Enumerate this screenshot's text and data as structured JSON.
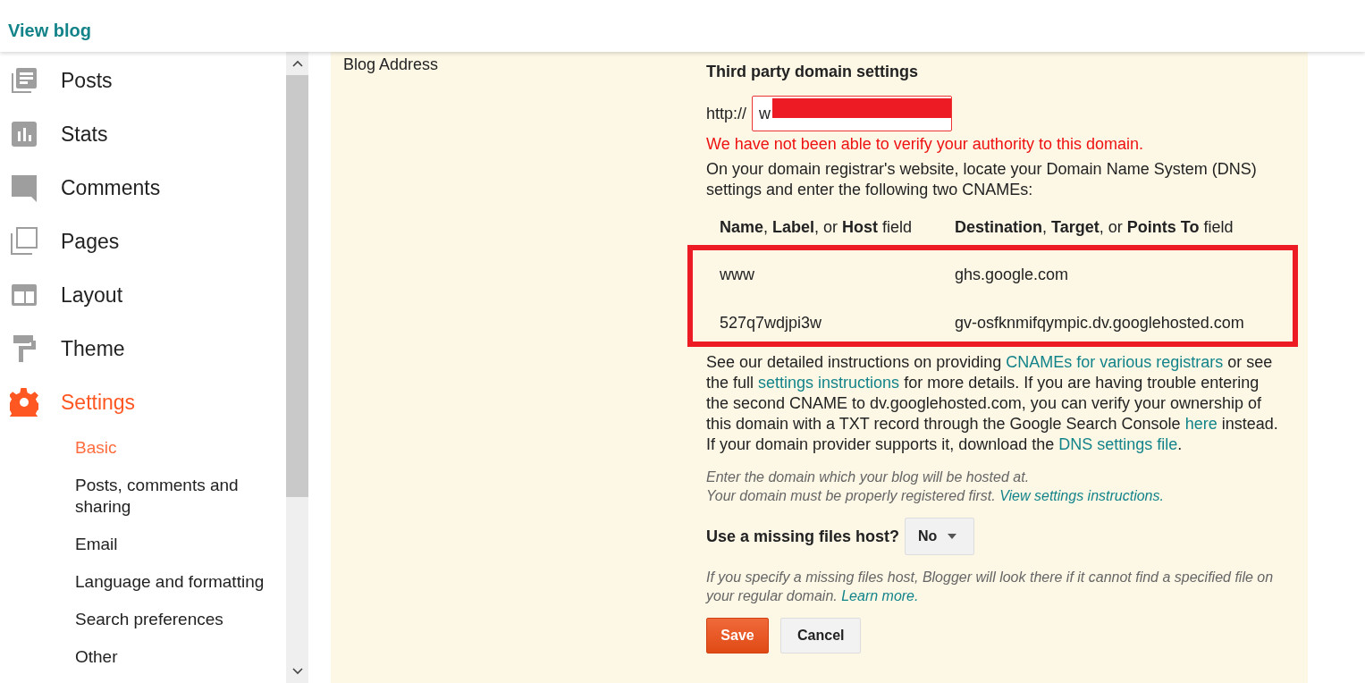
{
  "header": {
    "link": "View blog"
  },
  "sidebar": {
    "items": [
      {
        "label": "Posts",
        "kind": "posts",
        "selected": false
      },
      {
        "label": "Stats",
        "kind": "stats",
        "selected": false
      },
      {
        "label": "Comments",
        "kind": "comments",
        "selected": false
      },
      {
        "label": "Pages",
        "kind": "pages",
        "selected": false
      },
      {
        "label": "Layout",
        "kind": "layout",
        "selected": false
      },
      {
        "label": "Theme",
        "kind": "theme",
        "selected": false
      },
      {
        "label": "Settings",
        "kind": "settings",
        "selected": true
      }
    ],
    "subitems": [
      {
        "label": "Basic",
        "selected": true
      },
      {
        "label": "Posts, comments and sharing",
        "selected": false
      },
      {
        "label": "Email",
        "selected": false
      },
      {
        "label": "Language and formatting",
        "selected": false
      },
      {
        "label": "Search preferences",
        "selected": false
      },
      {
        "label": "Other",
        "selected": false
      }
    ]
  },
  "section": {
    "label": "Blog Address",
    "heading": "Third party domain settings",
    "prefix": "http://",
    "domain_value": "w",
    "domain_redacted": true,
    "error": "We have not been able to verify your authority to this domain.",
    "intro": "On your domain registrar's website, locate your Domain Name System (DNS) settings and enter the following two CNAMEs:",
    "table": {
      "columns": [
        "**Name**, **Label**, or **Host** field",
        "**Destination**, **Target**, or **Points To** field"
      ],
      "highlighted": true,
      "rows": [
        [
          "www",
          "ghs.google.com"
        ],
        [
          "527q7wdjpi3w",
          "gv-osfknmifqympic.dv.googlehosted.com"
        ]
      ]
    },
    "instructions": [
      {
        "kind": "text",
        "text": "See our detailed instructions on providing "
      },
      {
        "kind": "link",
        "text": "CNAMEs for various registrars"
      },
      {
        "kind": "text",
        "text": " or see the full "
      },
      {
        "kind": "link",
        "text": "settings instructions"
      },
      {
        "kind": "text",
        "text": " for more details. If you are having trouble entering the second CNAME to dv.googlehosted.com, you can verify your ownership of this domain with a TXT record through the Google Search Console "
      },
      {
        "kind": "link",
        "text": "here"
      },
      {
        "kind": "text",
        "text": " instead."
      },
      {
        "kind": "break"
      },
      {
        "kind": "text",
        "text": "If your domain provider supports it, download the "
      },
      {
        "kind": "link",
        "text": "DNS settings file"
      },
      {
        "kind": "text",
        "text": "."
      }
    ],
    "hint": [
      {
        "kind": "text",
        "text": "Enter the domain which your blog will be hosted at."
      },
      {
        "kind": "break"
      },
      {
        "kind": "text",
        "text": "Your domain must be properly registered first. "
      },
      {
        "kind": "link",
        "text": "View settings instructions."
      }
    ],
    "missing_host": {
      "label": "Use a missing files host?",
      "value": "No"
    },
    "missing_hint": [
      {
        "kind": "text",
        "text": "If you specify a missing files host, Blogger will look there if it cannot find a specified file on your regular domain. "
      },
      {
        "kind": "link",
        "text": "Learn more."
      }
    ],
    "buttons": [
      {
        "label": "Save",
        "kind": "primary"
      },
      {
        "label": "Cancel",
        "kind": "secondary"
      }
    ]
  }
}
